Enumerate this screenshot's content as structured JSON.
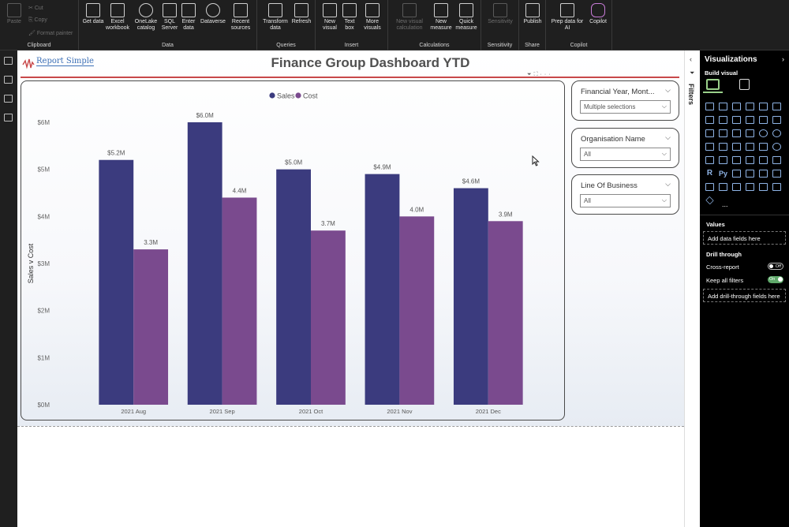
{
  "ribbon": {
    "clipboard": {
      "group": "Clipboard",
      "paste": "Paste",
      "cut": "Cut",
      "copy": "Copy",
      "format_painter": "Format painter"
    },
    "data": {
      "group": "Data",
      "buttons": [
        "Get data",
        "Excel workbook",
        "OneLake catalog",
        "SQL Server",
        "Enter data",
        "Dataverse",
        "Recent sources"
      ]
    },
    "queries": {
      "group": "Queries",
      "buttons": [
        "Transform data",
        "Refresh"
      ]
    },
    "insert": {
      "group": "Insert",
      "buttons": [
        "New visual",
        "Text box",
        "More visuals"
      ]
    },
    "calculations": {
      "group": "Calculations",
      "buttons": [
        "New visual calculation",
        "New measure",
        "Quick measure"
      ]
    },
    "sensitivity": {
      "group": "Sensitivity",
      "buttons": [
        "Sensitivity"
      ]
    },
    "share": {
      "group": "Share",
      "buttons": [
        "Publish"
      ]
    },
    "copilot": {
      "group": "Copilot",
      "buttons": [
        "Prep data for AI",
        "Copilot"
      ]
    }
  },
  "report": {
    "logo_text": "Report Simple",
    "title": "Finance Group Dashboard YTD"
  },
  "slicers": [
    {
      "label": "Financial Year, Mont...",
      "value": "Multiple selections"
    },
    {
      "label": "Organisation Name",
      "value": "All"
    },
    {
      "label": "Line Of Business",
      "value": "All"
    }
  ],
  "filters_pane": {
    "label": "Filters"
  },
  "visualizations_pane": {
    "title": "Visualizations",
    "build_visual": "Build visual",
    "more": "...",
    "values_section": "Values",
    "values_drop": "Add data fields here",
    "drill_through": "Drill through",
    "cross_report": "Cross-report",
    "cross_report_state": "Off",
    "keep_all_filters": "Keep all filters",
    "keep_all_filters_state": "On",
    "drill_drop": "Add drill-through fields here"
  },
  "colors": {
    "sales": "#3b3b7e",
    "cost": "#7a4a8e",
    "title_rule": "#c8484a"
  },
  "chart_data": {
    "type": "bar",
    "categories": [
      "2021 Aug",
      "2021 Sep",
      "2021 Oct",
      "2021 Nov",
      "2021 Dec"
    ],
    "series": [
      {
        "name": "Sales",
        "values": [
          5.2,
          6.0,
          5.0,
          4.9,
          4.6
        ],
        "labels": [
          "$5.2M",
          "$6.0M",
          "$5.0M",
          "$4.9M",
          "$4.6M"
        ]
      },
      {
        "name": "Cost",
        "values": [
          3.3,
          4.4,
          3.7,
          4.0,
          3.9
        ],
        "labels": [
          "3.3M",
          "4.4M",
          "3.7M",
          "4.0M",
          "3.9M"
        ]
      }
    ],
    "ylabel": "Sales v Cost",
    "ylim": [
      0,
      6
    ],
    "yticks": [
      0,
      1,
      2,
      3,
      4,
      5,
      6
    ],
    "ytick_labels": [
      "$0M",
      "$1M",
      "$2M",
      "$3M",
      "$4M",
      "$5M",
      "$6M"
    ],
    "legend": "top-center",
    "grid": false
  }
}
